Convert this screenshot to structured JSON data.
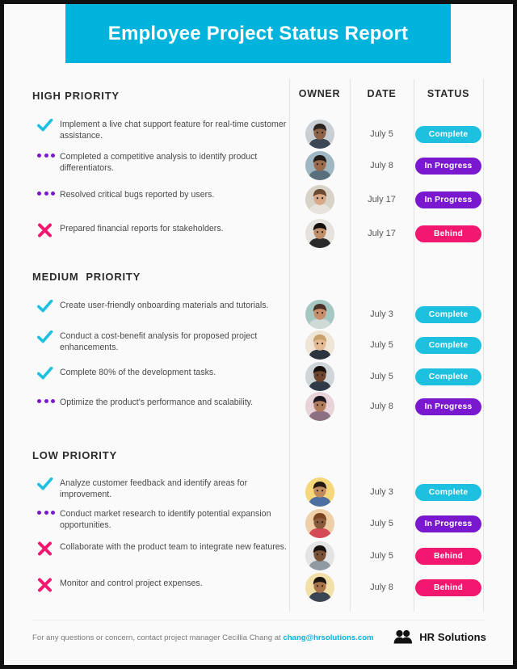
{
  "header": {
    "title": "Employee Project Status Report",
    "banner_color": "#00b3dd"
  },
  "columns": {
    "owner": "OWNER",
    "date": "DATE",
    "status": "STATUS"
  },
  "status_colors": {
    "complete": "#1ec0e0",
    "in_progress": "#7a18d0",
    "behind": "#f2186f"
  },
  "icon_colors": {
    "check": "#1ec0e0",
    "dots": "#7a18d0",
    "cross": "#f2186f"
  },
  "sections": [
    {
      "heading": "HIGH PRIORITY",
      "rows": [
        {
          "icon": "check-icon",
          "task": "Implement a live chat support feature for real-time customer assistance.",
          "owner": "avatar-bearded-man-suit",
          "date": "July 5",
          "status": "Complete",
          "status_key": "complete"
        },
        {
          "icon": "three-dots-icon",
          "task": "Completed a competitive analysis to identify product differentiators.",
          "owner": "avatar-woman-glasses",
          "date": "July 8",
          "status": "In Progress",
          "status_key": "inprogress"
        },
        {
          "icon": "three-dots-icon",
          "task": "Resolved critical bugs reported by users.",
          "owner": "avatar-smiling-woman-curly",
          "date": "July 17",
          "status": "In Progress",
          "status_key": "inprogress"
        },
        {
          "icon": "cross-icon",
          "task": "Prepared financial reports for stakeholders.",
          "owner": "avatar-man-dark-hair",
          "date": "July 17",
          "status": "Behind",
          "status_key": "behind"
        }
      ]
    },
    {
      "heading": "MEDIUM  PRIORITY",
      "rows": [
        {
          "icon": "check-icon",
          "task": "Create user-friendly onboarding materials and tutorials.",
          "owner": "avatar-woman-teal-background",
          "date": "July 3",
          "status": "Complete",
          "status_key": "complete"
        },
        {
          "icon": "check-icon",
          "task": "Conduct a cost-benefit analysis for proposed project enhancements.",
          "owner": "avatar-blonde-woman",
          "date": "July 5",
          "status": "Complete",
          "status_key": "complete"
        },
        {
          "icon": "check-icon",
          "task": "Complete 80% of the development tasks.",
          "owner": "avatar-man-dark-skin",
          "date": "July 5",
          "status": "Complete",
          "status_key": "complete"
        },
        {
          "icon": "three-dots-icon",
          "task": "Optimize the product's performance and scalability.",
          "owner": "avatar-woman-headscarf",
          "date": "July 8",
          "status": "In Progress",
          "status_key": "inprogress"
        }
      ]
    },
    {
      "heading": "LOW PRIORITY",
      "rows": [
        {
          "icon": "check-icon",
          "task": "Analyze customer feedback and identify areas for improvement.",
          "owner": "avatar-man-glasses-yellow",
          "date": "July 3",
          "status": "Complete",
          "status_key": "complete"
        },
        {
          "icon": "three-dots-icon",
          "task": "Conduct market research to identify potential expansion opportunities.",
          "owner": "avatar-woman-curly-hair",
          "date": "July 5",
          "status": "In Progress",
          "status_key": "inprogress"
        },
        {
          "icon": "cross-icon",
          "task": "Collaborate with the product team to integrate new features.",
          "owner": "avatar-woman-braids",
          "date": "July 5",
          "status": "Behind",
          "status_key": "behind"
        },
        {
          "icon": "cross-icon",
          "task": "Monitor and control project expenses.",
          "owner": "avatar-man-glasses-cream",
          "date": "July 8",
          "status": "Behind",
          "status_key": "behind"
        }
      ]
    }
  ],
  "footer": {
    "text_before": "For any questions or concern, contact project manager Cecillia Chang at ",
    "email": "chang@hrsolutions.com",
    "logo_text": "HR Solutions"
  }
}
